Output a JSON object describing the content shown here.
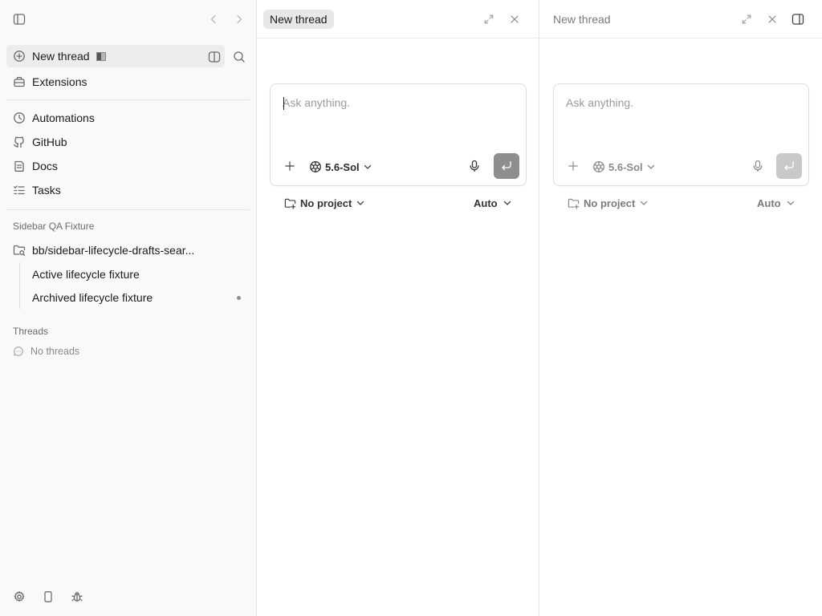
{
  "sidebar": {
    "new_thread_label": "New thread",
    "extensions_label": "Extensions",
    "nav": [
      {
        "label": "Automations",
        "icon": "clock-icon"
      },
      {
        "label": "GitHub",
        "icon": "github-icon"
      },
      {
        "label": "Docs",
        "icon": "book-icon"
      },
      {
        "label": "Tasks",
        "icon": "checklist-icon"
      }
    ],
    "project": {
      "section_title": "Sidebar QA Fixture",
      "folder_label": "bb/sidebar-lifecycle-drafts-sear...",
      "items": [
        {
          "label": "Active lifecycle fixture"
        },
        {
          "label": "Archived lifecycle fixture"
        }
      ]
    },
    "threads": {
      "section_title": "Threads",
      "empty_label": "No threads"
    }
  },
  "panes": [
    {
      "title": "New thread",
      "active": true,
      "composer": {
        "placeholder": "Ask anything.",
        "value": "",
        "model_label": "5.6-Sol"
      },
      "project_label": "No project",
      "mode_label": "Auto"
    },
    {
      "title": "New thread",
      "active": false,
      "composer": {
        "placeholder": "Ask anything.",
        "value": "",
        "model_label": "5.6-Sol"
      },
      "project_label": "No project",
      "mode_label": "Auto"
    }
  ],
  "colors": {
    "sidebar_bg": "#f9f9f9",
    "active_row_bg": "#ececec",
    "send_active": "#8e8e8e",
    "send_inactive": "#c9c9c9"
  }
}
